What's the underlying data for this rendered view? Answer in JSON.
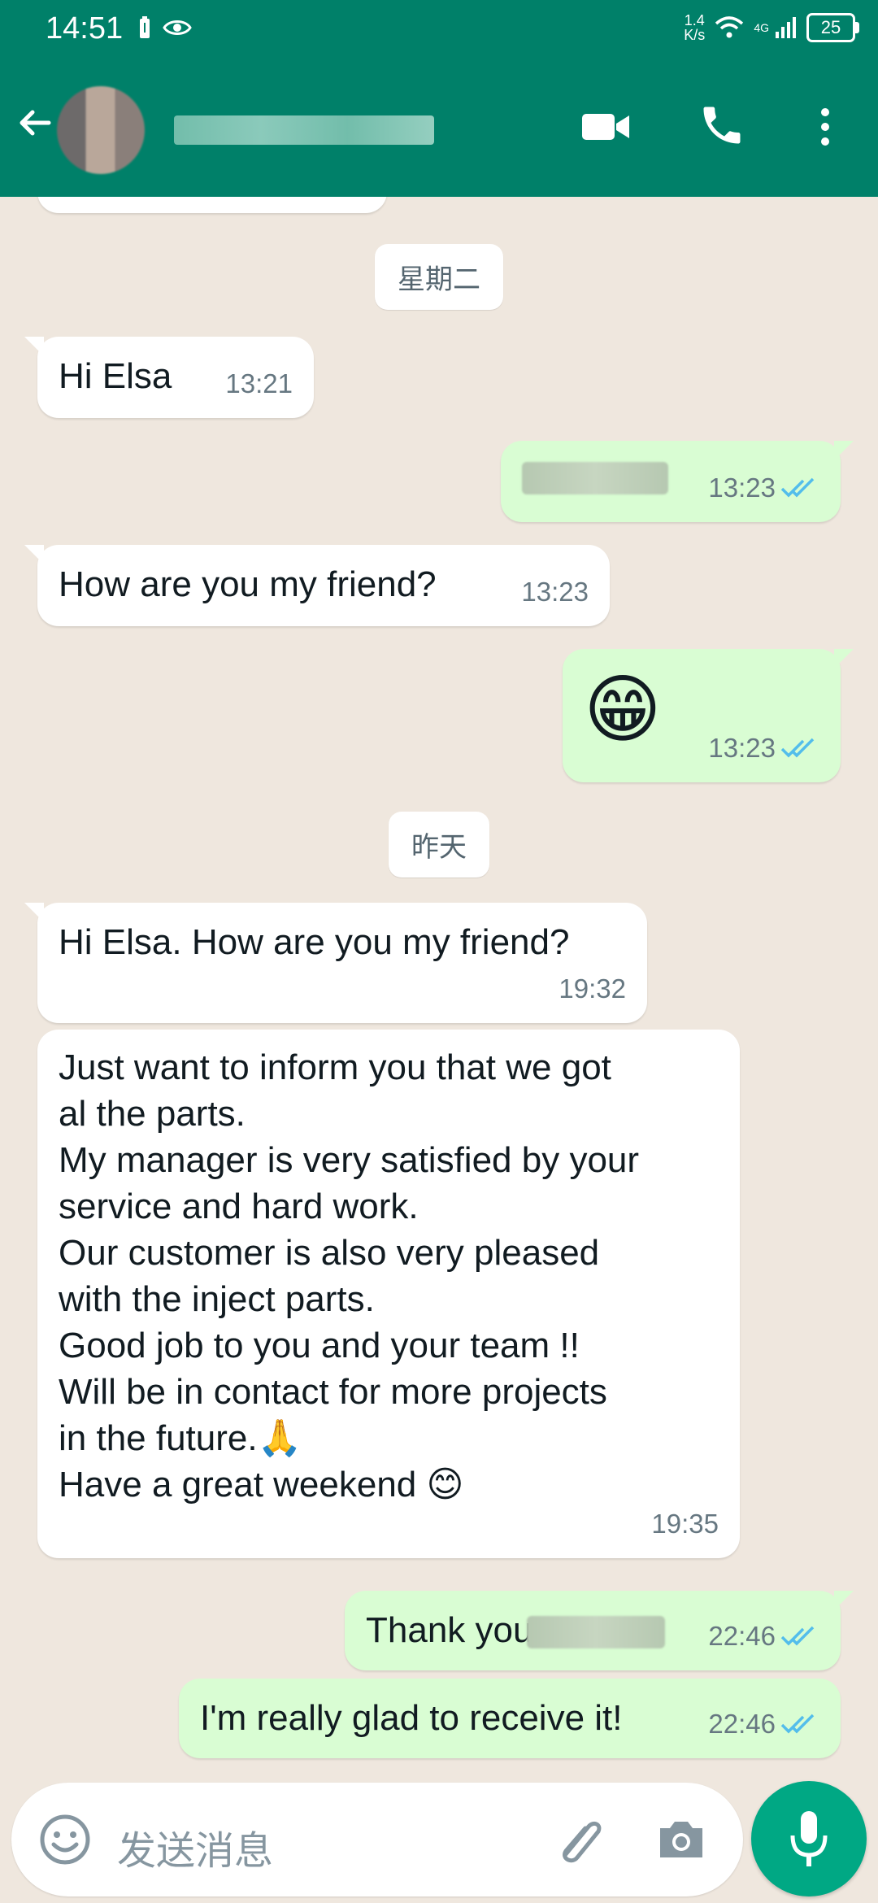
{
  "status_bar": {
    "time": "14:51",
    "net_speed_value": "1.4",
    "net_speed_unit": "K/s",
    "network_type": "4G",
    "battery": "25"
  },
  "header": {
    "avatar_icon": "avatar-blurred",
    "contact_name_redacted": true
  },
  "chat": {
    "messages": [
      {
        "type": "date",
        "label": "星期二"
      },
      {
        "type": "in",
        "text": "Hi Elsa",
        "time": "13:21"
      },
      {
        "type": "out",
        "text_redacted": true,
        "time": "13:23"
      },
      {
        "type": "in",
        "text": "How are you my friend?",
        "time": "13:23"
      },
      {
        "type": "out",
        "emoji": "😁",
        "time": "13:23"
      },
      {
        "type": "date",
        "label": "昨天"
      },
      {
        "type": "in",
        "text": "Hi Elsa. How are you my friend?",
        "time": "19:32"
      },
      {
        "type": "in",
        "lines": [
          "Just want to inform you that we got",
          "al the parts.",
          "My manager is very satisfied by your",
          "service and hard work.",
          "Our customer is also very pleased",
          "with the inject parts.",
          "Good job to you and your team !!",
          "Will be in contact for more projects",
          "in the future.🙏",
          "Have a great weekend 😊"
        ],
        "time": "19:35"
      },
      {
        "type": "out",
        "text": "Thank you",
        "time": "22:46"
      },
      {
        "type": "out",
        "text": "I'm really glad to receive it!",
        "time": "22:46"
      }
    ]
  },
  "input": {
    "placeholder": "发送消息"
  },
  "colors": {
    "header": "#008069",
    "outgoing_bubble": "#d9fdd3",
    "incoming_bubble": "#ffffff",
    "read_ticks": "#53bdeb",
    "mic_button": "#00a884"
  }
}
